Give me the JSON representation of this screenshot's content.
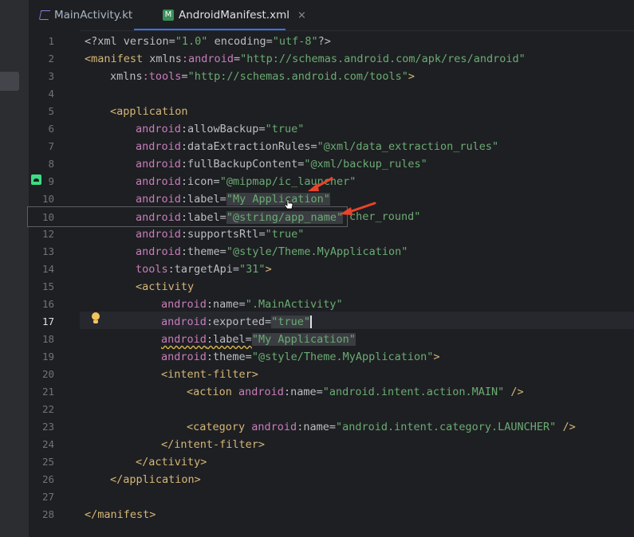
{
  "tabs": [
    {
      "label": "MainActivity.kt",
      "icon": "kotlin-file-icon",
      "active": false
    },
    {
      "label": "AndroidManifest.xml",
      "icon": "manifest-file-icon",
      "active": true,
      "close": "×"
    }
  ],
  "manifest_icon_letter": "M",
  "line_numbers": [
    "1",
    "2",
    "3",
    "4",
    "5",
    "6",
    "7",
    "8",
    "9",
    "10",
    "",
    "12",
    "13",
    "14",
    "15",
    "16",
    "17",
    "18",
    "19",
    "20",
    "21",
    "22",
    "23",
    "24",
    "25",
    "26",
    "27",
    "28"
  ],
  "current_line": "17",
  "code": {
    "l1": {
      "a": "<?xml version=",
      "b": "\"1.0\"",
      "c": " encoding=",
      "d": "\"utf-8\"",
      "e": "?>"
    },
    "l2": {
      "a": "<manifest ",
      "b": "xmlns",
      "c": ":android",
      "d": "=",
      "e": "\"http://schemas.android.com/apk/res/android\""
    },
    "l3": {
      "a": "xmlns",
      "b": ":tools",
      "c": "=",
      "d": "\"http://schemas.android.com/tools\"",
      "e": ">"
    },
    "l5": {
      "a": "<application"
    },
    "l6": {
      "ns": "android",
      "attr": ":allowBackup=",
      "val": "\"true\""
    },
    "l7": {
      "ns": "android",
      "attr": ":dataExtractionRules=",
      "val": "\"@xml/data_extraction_rules\""
    },
    "l8": {
      "ns": "android",
      "attr": ":fullBackupContent=",
      "val": "\"@xml/backup_rules\""
    },
    "l9": {
      "ns": "android",
      "attr": ":icon=",
      "val": "\"@mipmap/ic_launcher\""
    },
    "l10": {
      "ns": "android",
      "attr": ":label=",
      "val": "\"My Application\""
    },
    "l11": {
      "tail": "cher_round\""
    },
    "l12": {
      "ns": "android",
      "attr": ":supportsRtl=",
      "val": "\"true\""
    },
    "l13": {
      "ns": "android",
      "attr": ":theme=",
      "val": "\"@style/Theme.MyApplication\""
    },
    "l14": {
      "ns": "tools",
      "attr": ":targetApi=",
      "val": "\"31\"",
      "end": ">"
    },
    "l15": {
      "a": "<activity"
    },
    "l16": {
      "ns": "android",
      "attr": ":name=",
      "val": "\".MainActivity\""
    },
    "l17": {
      "ns": "android",
      "attr": ":exported=",
      "val": "\"true\""
    },
    "l18": {
      "ns": "android",
      "attr": ":label=",
      "val": "\"My Application\""
    },
    "l19": {
      "ns": "android",
      "attr": ":theme=",
      "val": "\"@style/Theme.MyApplication\"",
      "end": ">"
    },
    "l20": {
      "a": "<intent-filter>"
    },
    "l21": {
      "a": "<action ",
      "ns": "android",
      "attr": ":name=",
      "val": "\"android.intent.action.MAIN\"",
      "end": " />"
    },
    "l23": {
      "a": "<category ",
      "ns": "android",
      "attr": ":name=",
      "val": "\"android.intent.category.LAUNCHER\"",
      "end": " />"
    },
    "l24": {
      "a": "</intent-filter>"
    },
    "l25": {
      "a": "</activity>"
    },
    "l26": {
      "a": "</application>"
    },
    "l28": {
      "a": "</manifest>"
    }
  },
  "popup": {
    "line_number": "10",
    "ns": "android",
    "attr": ":label=",
    "val": "\"@string/app_name\""
  },
  "colors": {
    "background": "#1e1f22",
    "tag": "#d5b778",
    "namespace": "#c77dbb",
    "string": "#6aab73",
    "accent": "#3574f0",
    "arrow": "#e8442c"
  }
}
